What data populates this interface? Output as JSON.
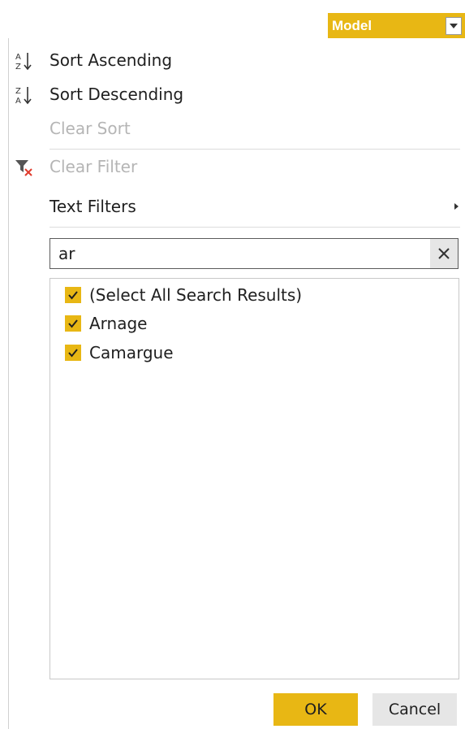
{
  "column_header": {
    "label": "Model"
  },
  "menu": {
    "sort_ascending": "Sort Ascending",
    "sort_descending": "Sort Descending",
    "clear_sort": "Clear Sort",
    "clear_filter": "Clear Filter",
    "text_filters": "Text Filters"
  },
  "search": {
    "value": "ar"
  },
  "results": [
    {
      "label": "(Select All Search Results)",
      "checked": true
    },
    {
      "label": "Arnage",
      "checked": true
    },
    {
      "label": "Camargue",
      "checked": true
    }
  ],
  "buttons": {
    "ok": "OK",
    "cancel": "Cancel"
  },
  "colors": {
    "accent": "#e8b714",
    "disabled_text": "#b5b5b5",
    "clear_filter_icon_x": "#e03c2e"
  }
}
